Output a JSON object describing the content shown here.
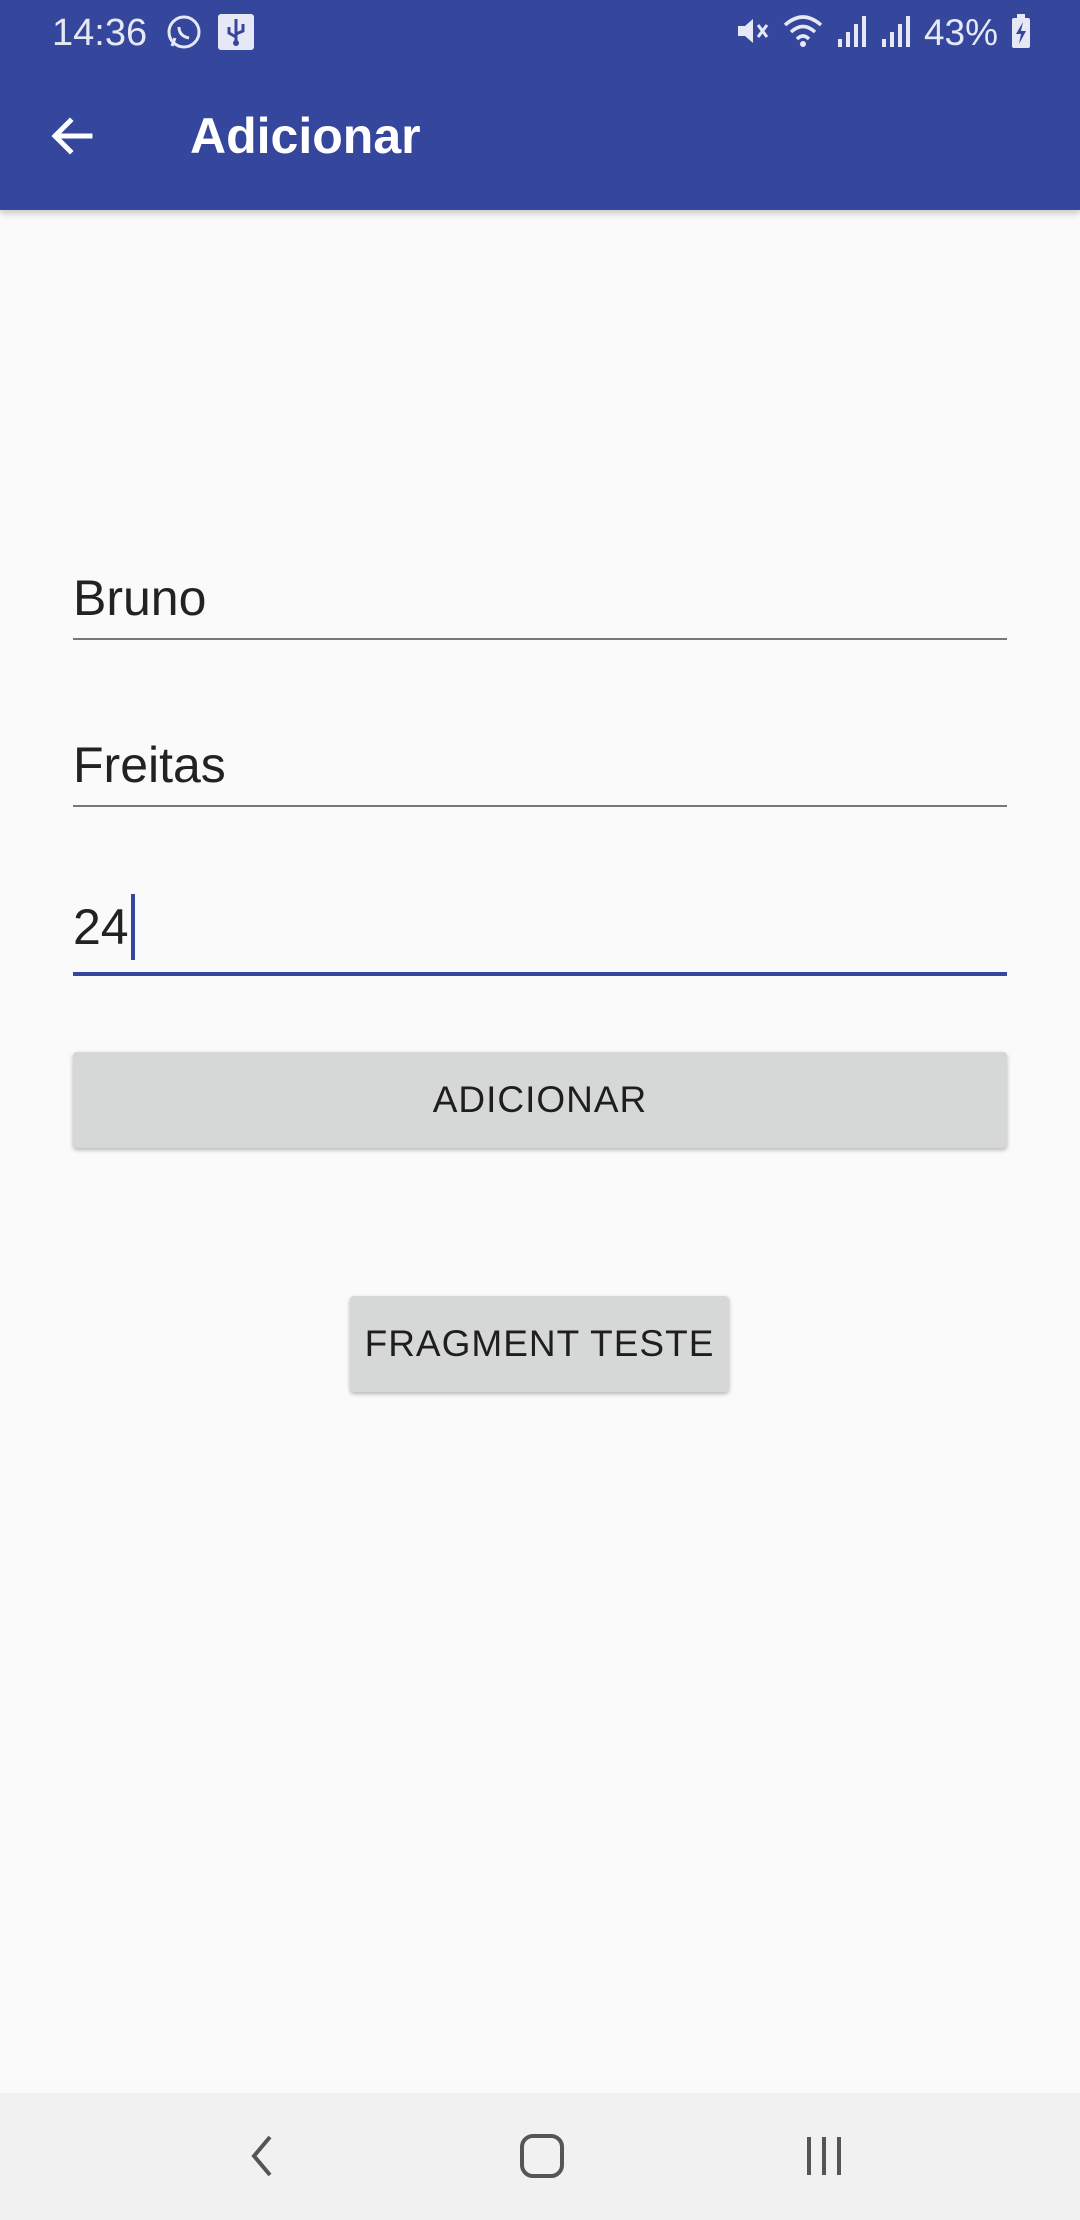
{
  "status_bar": {
    "time": "14:36",
    "battery": "43%",
    "left_icons": [
      "whatsapp-icon",
      "usb-icon"
    ],
    "right_icons": [
      "mute-icon",
      "wifi-icon",
      "signal-icon",
      "signal-icon",
      "battery-charging-icon"
    ]
  },
  "app_bar": {
    "title": "Adicionar",
    "back_icon": "arrow-back-icon"
  },
  "form": {
    "first_name": "Bruno",
    "last_name": "Freitas",
    "age": "24"
  },
  "buttons": {
    "add_label": "ADICIONAR",
    "fragment_label": "FRAGMENT TESTE"
  },
  "nav_bar": {
    "back_icon": "chevron-left-icon",
    "home_icon": "home-icon",
    "recents_icon": "recents-icon"
  },
  "colors": {
    "primary": "#35469d",
    "background": "#fafafa",
    "button": "#d6d7d7",
    "nav_bar": "#f1f1f1"
  }
}
